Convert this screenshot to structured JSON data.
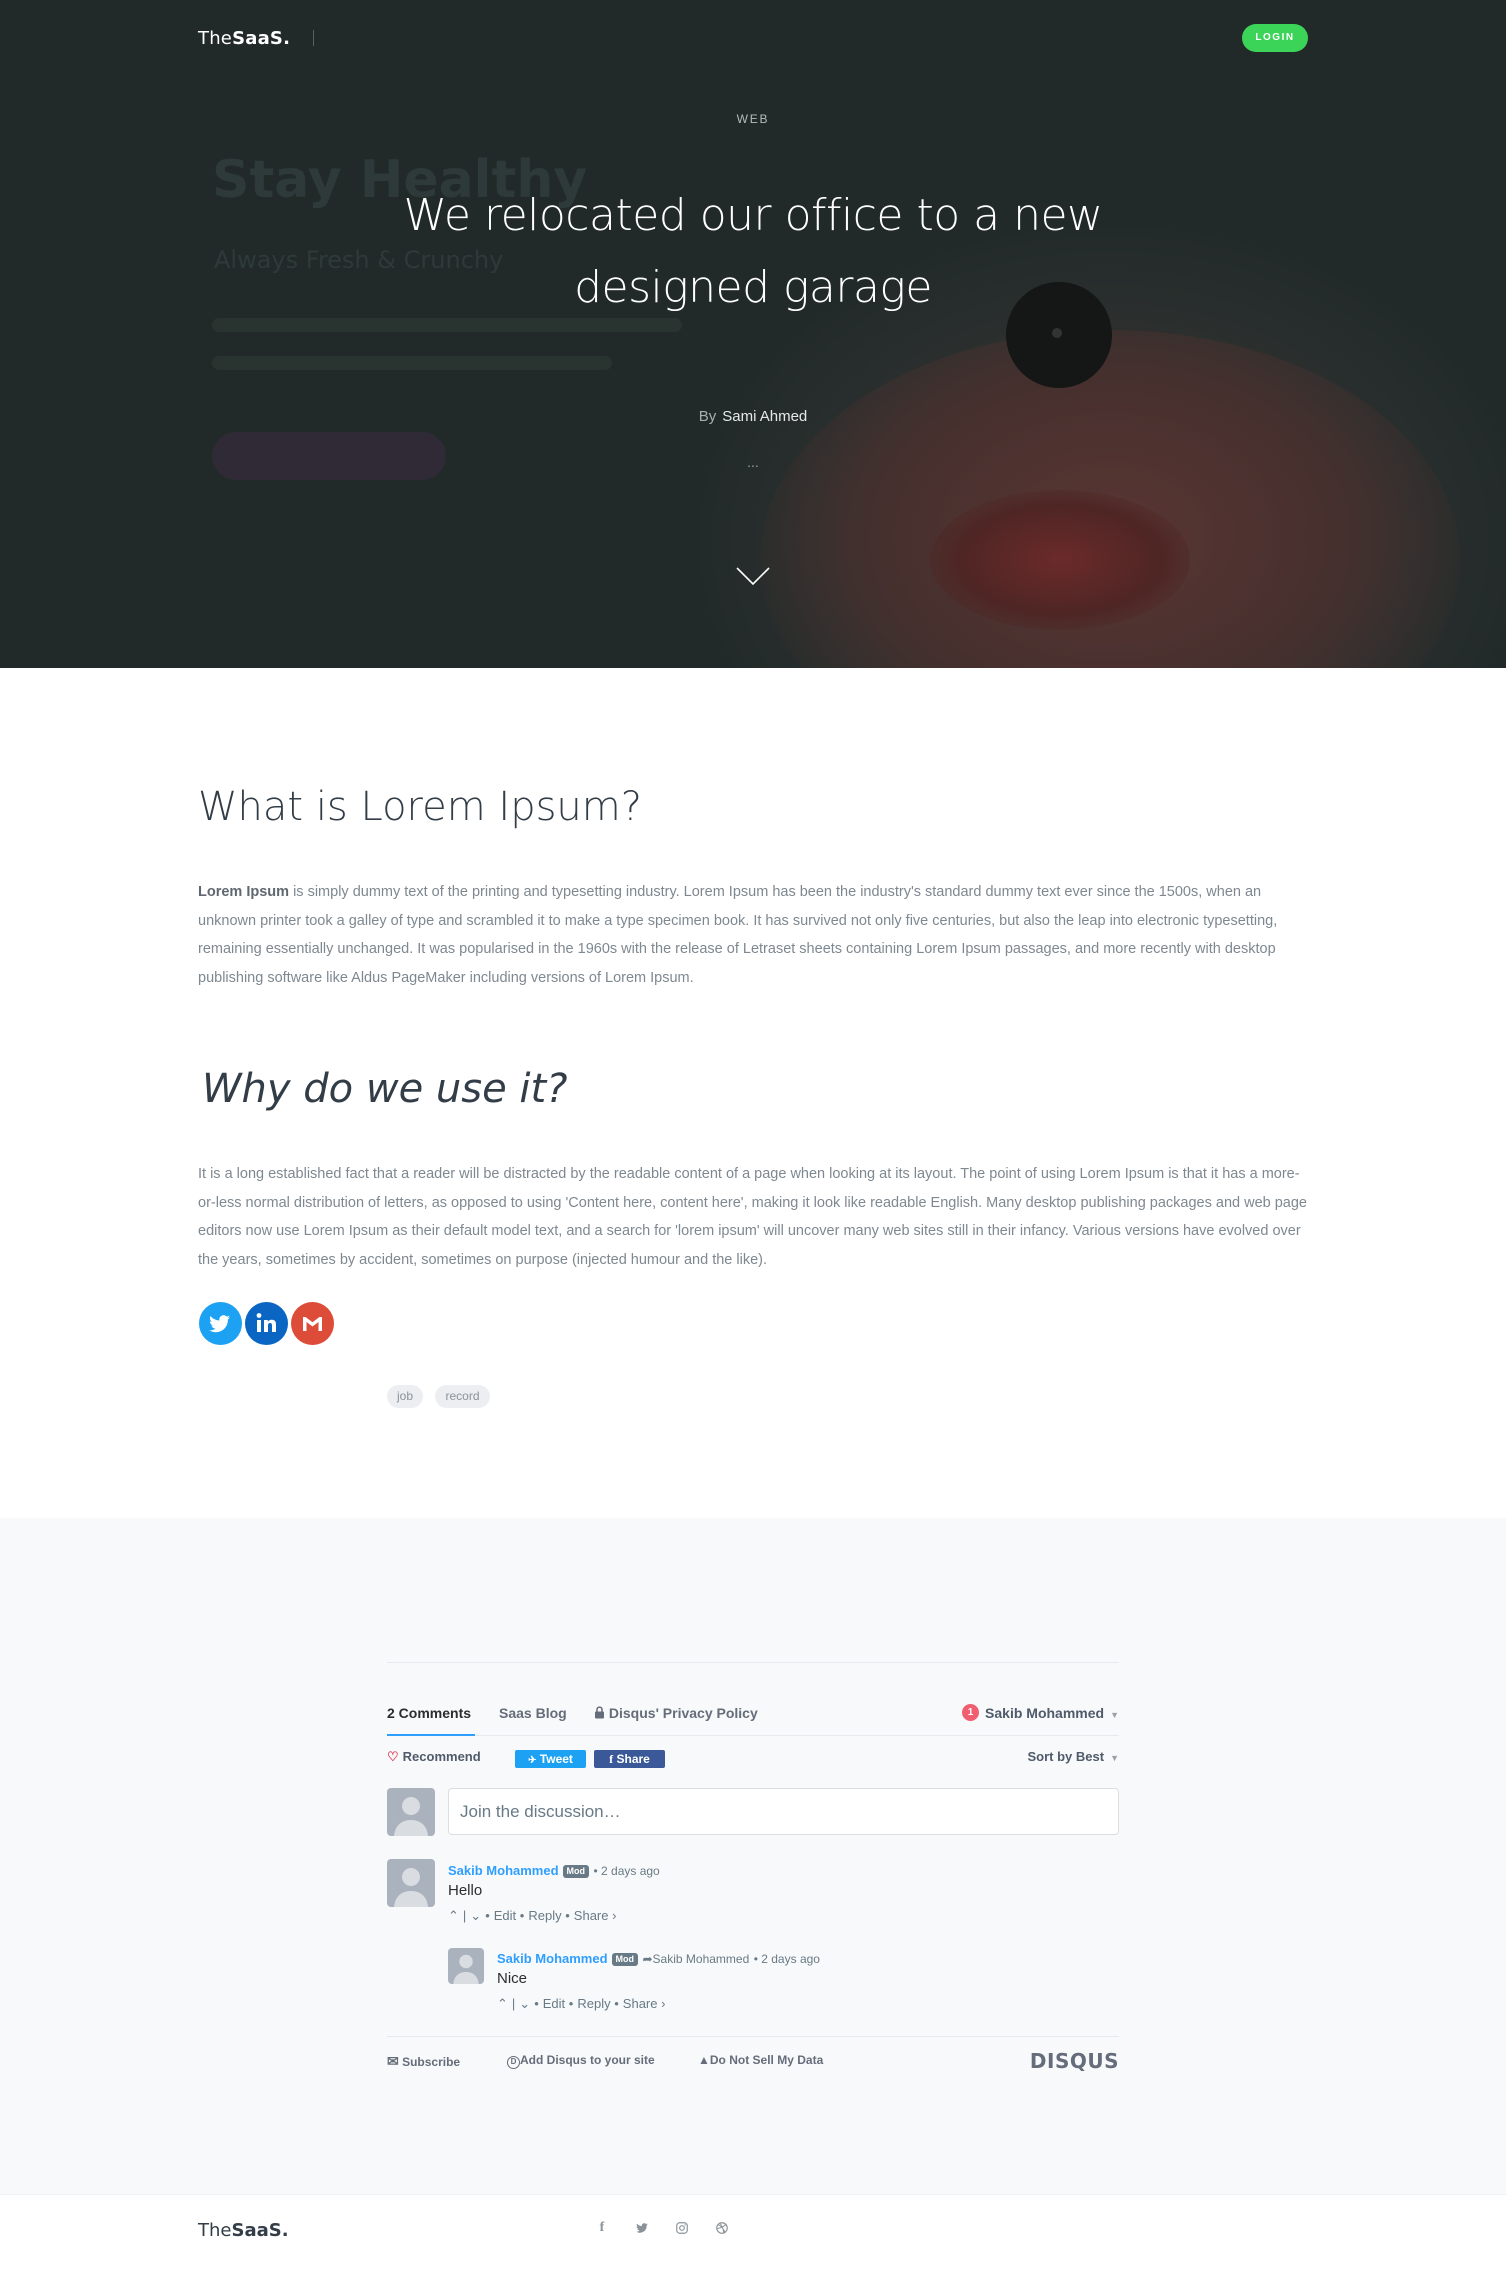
{
  "nav": {
    "logo_light": "The",
    "logo_bold": "SaaS.",
    "login_label": "LOGIN"
  },
  "hero": {
    "category": "WEB",
    "title": "We relocated our office to a new designed garage",
    "by_label": "By",
    "author": "Sami Ahmed",
    "dots": "...",
    "background_ghost_title": "Stay Healthy",
    "background_ghost_subtitle": "Always Fresh & Crunchy",
    "chevron_icon": "chevron-down-icon"
  },
  "article": {
    "heading1": "What is Lorem Ipsum?",
    "para1_bold": "Lorem Ipsum",
    "para1_rest": " is simply dummy text of the printing and typesetting industry. Lorem Ipsum has been the industry's standard dummy text ever since the 1500s, when an unknown printer took a galley of type and scrambled it to make a type specimen book. It has survived not only five centuries, but also the leap into electronic typesetting, remaining essentially unchanged. It was popularised in the 1960s with the release of Letraset sheets containing Lorem Ipsum passages, and more recently with desktop publishing software like Aldus PageMaker including versions of Lorem Ipsum.",
    "heading2": "Why do we use it?",
    "para2": "It is a long established fact that a reader will be distracted by the readable content of a page when looking at its layout. The point of using Lorem Ipsum is that it has a more-or-less normal distribution of letters, as opposed to using 'Content here, content here', making it look like readable English. Many desktop publishing packages and web page editors now use Lorem Ipsum as their default model text, and a search for 'lorem ipsum' will uncover many web sites still in their infancy. Various versions have evolved over the years, sometimes by accident, sometimes on purpose (injected humour and the like).",
    "share": [
      {
        "icon": "twitter-icon",
        "color": "#1da1f2"
      },
      {
        "icon": "linkedin-icon",
        "color": "#0a66c2"
      },
      {
        "icon": "gmail-icon",
        "color": "#dd4b39"
      }
    ],
    "tags": [
      "job",
      "record"
    ]
  },
  "disqus": {
    "tab_comments": "2 Comments",
    "tab_blog": "Saas Blog",
    "tab_privacy": "Disqus' Privacy Policy",
    "notification_count": "1",
    "user_name": "Sakib Mohammed",
    "recommend_label": "Recommend",
    "tweet_label": "Tweet",
    "share_label": "Share",
    "sort_label": "Sort by Best",
    "input_placeholder": "Join the discussion…",
    "comments": [
      {
        "author": "Sakib Mohammed",
        "badge": "Mod",
        "time": "• 2 days ago",
        "text": "Hello",
        "actions": [
          "Edit",
          "Reply",
          "Share ›"
        ]
      },
      {
        "author": "Sakib Mohammed",
        "badge": "Mod",
        "reply_to": "Sakib Mohammed",
        "time": "• 2 days ago",
        "text": "Nice",
        "actions": [
          "Edit",
          "Reply",
          "Share ›"
        ]
      }
    ],
    "footer": {
      "subscribe": "Subscribe",
      "add_disqus": "Add Disqus to your site",
      "do_not_sell": "Do Not Sell My Data",
      "logo": "DISQUS"
    },
    "accent_color": "#2e9fff"
  },
  "footer": {
    "logo_light": "The",
    "logo_bold": "SaaS.",
    "social": [
      "facebook-icon",
      "twitter-icon",
      "instagram-icon",
      "dribbble-icon"
    ]
  },
  "colors": {
    "login_green": "#3cd458",
    "heading": "#323d47",
    "body_text": "#7e8890"
  }
}
